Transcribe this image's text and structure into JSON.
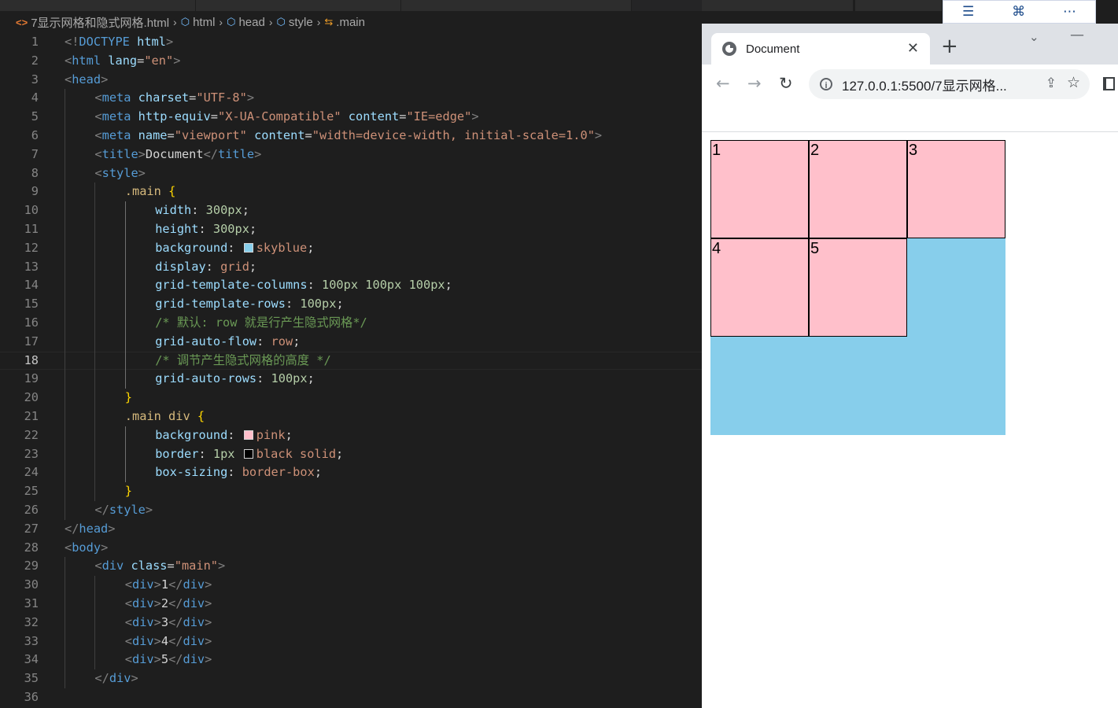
{
  "editor": {
    "breadcrumb": [
      "7显示网格和隐式网格.html",
      "html",
      "head",
      "style",
      ".main"
    ],
    "lines": [
      {
        "n": "1",
        "indent": 0,
        "tokens": [
          [
            "tg",
            "<!"
          ],
          [
            "tn",
            "DOCTYPE"
          ],
          [
            "tx",
            " "
          ],
          [
            "an",
            "html"
          ],
          [
            "tg",
            ">"
          ]
        ]
      },
      {
        "n": "2",
        "indent": 0,
        "tokens": [
          [
            "tg",
            "<"
          ],
          [
            "tn",
            "html"
          ],
          [
            "tx",
            " "
          ],
          [
            "an",
            "lang"
          ],
          [
            "tx",
            "="
          ],
          [
            "av",
            "\"en\""
          ],
          [
            "tg",
            ">"
          ]
        ]
      },
      {
        "n": "3",
        "indent": 0,
        "tokens": [
          [
            "tg",
            "<"
          ],
          [
            "tn",
            "head"
          ],
          [
            "tg",
            ">"
          ]
        ]
      },
      {
        "n": "4",
        "indent": 1,
        "tokens": [
          [
            "tg",
            "<"
          ],
          [
            "tn",
            "meta"
          ],
          [
            "tx",
            " "
          ],
          [
            "an",
            "charset"
          ],
          [
            "tx",
            "="
          ],
          [
            "av",
            "\"UTF-8\""
          ],
          [
            "tg",
            ">"
          ]
        ]
      },
      {
        "n": "5",
        "indent": 1,
        "tokens": [
          [
            "tg",
            "<"
          ],
          [
            "tn",
            "meta"
          ],
          [
            "tx",
            " "
          ],
          [
            "an",
            "http-equiv"
          ],
          [
            "tx",
            "="
          ],
          [
            "av",
            "\"X-UA-Compatible\""
          ],
          [
            "tx",
            " "
          ],
          [
            "an",
            "content"
          ],
          [
            "tx",
            "="
          ],
          [
            "av",
            "\"IE=edge\""
          ],
          [
            "tg",
            ">"
          ]
        ]
      },
      {
        "n": "6",
        "indent": 1,
        "tokens": [
          [
            "tg",
            "<"
          ],
          [
            "tn",
            "meta"
          ],
          [
            "tx",
            " "
          ],
          [
            "an",
            "name"
          ],
          [
            "tx",
            "="
          ],
          [
            "av",
            "\"viewport\""
          ],
          [
            "tx",
            " "
          ],
          [
            "an",
            "content"
          ],
          [
            "tx",
            "="
          ],
          [
            "av",
            "\"width=device-width, initial-scale=1.0\""
          ],
          [
            "tg",
            ">"
          ]
        ]
      },
      {
        "n": "7",
        "indent": 1,
        "tokens": [
          [
            "tg",
            "<"
          ],
          [
            "tn",
            "title"
          ],
          [
            "tg",
            ">"
          ],
          [
            "tx",
            "Document"
          ],
          [
            "tg",
            "</"
          ],
          [
            "tn",
            "title"
          ],
          [
            "tg",
            ">"
          ]
        ]
      },
      {
        "n": "8",
        "indent": 1,
        "tokens": [
          [
            "tg",
            "<"
          ],
          [
            "tn",
            "style"
          ],
          [
            "tg",
            ">"
          ]
        ]
      },
      {
        "n": "9",
        "indent": 2,
        "tokens": [
          [
            "sel",
            ".main"
          ],
          [
            "tx",
            " "
          ],
          [
            "br",
            "{"
          ]
        ]
      },
      {
        "n": "10",
        "indent": 3,
        "tokens": [
          [
            "pn",
            "width"
          ],
          [
            "tx",
            ": "
          ],
          [
            "nm",
            "300px"
          ],
          [
            "tx",
            ";"
          ]
        ]
      },
      {
        "n": "11",
        "indent": 3,
        "tokens": [
          [
            "pn",
            "height"
          ],
          [
            "tx",
            ": "
          ],
          [
            "nm",
            "300px"
          ],
          [
            "tx",
            ";"
          ]
        ]
      },
      {
        "n": "12",
        "indent": 3,
        "tokens": [
          [
            "pn",
            "background"
          ],
          [
            "tx",
            ": "
          ],
          [
            "swatch",
            "#87ceeb"
          ],
          [
            "kw",
            "skyblue"
          ],
          [
            "tx",
            ";"
          ]
        ]
      },
      {
        "n": "13",
        "indent": 3,
        "tokens": [
          [
            "pn",
            "display"
          ],
          [
            "tx",
            ": "
          ],
          [
            "kw",
            "grid"
          ],
          [
            "tx",
            ";"
          ]
        ]
      },
      {
        "n": "14",
        "indent": 3,
        "tokens": [
          [
            "pn",
            "grid-template-columns"
          ],
          [
            "tx",
            ": "
          ],
          [
            "nm",
            "100px"
          ],
          [
            "tx",
            " "
          ],
          [
            "nm",
            "100px"
          ],
          [
            "tx",
            " "
          ],
          [
            "nm",
            "100px"
          ],
          [
            "tx",
            ";"
          ]
        ]
      },
      {
        "n": "15",
        "indent": 3,
        "tokens": [
          [
            "pn",
            "grid-template-rows"
          ],
          [
            "tx",
            ": "
          ],
          [
            "nm",
            "100px"
          ],
          [
            "tx",
            ";"
          ]
        ]
      },
      {
        "n": "16",
        "indent": 3,
        "tokens": [
          [
            "cm",
            "/* 默认: row 就是行产生隐式网格*/"
          ]
        ]
      },
      {
        "n": "17",
        "indent": 3,
        "tokens": [
          [
            "pn",
            "grid-auto-flow"
          ],
          [
            "tx",
            ": "
          ],
          [
            "kw",
            "row"
          ],
          [
            "tx",
            ";"
          ]
        ]
      },
      {
        "n": "18",
        "indent": 3,
        "current": true,
        "tokens": [
          [
            "cm",
            "/* 调节产生隐式网格的高度 */"
          ]
        ]
      },
      {
        "n": "19",
        "indent": 3,
        "tokens": [
          [
            "pn",
            "grid-auto-rows"
          ],
          [
            "tx",
            ": "
          ],
          [
            "nm",
            "100px"
          ],
          [
            "tx",
            ";"
          ]
        ]
      },
      {
        "n": "20",
        "indent": 2,
        "tokens": [
          [
            "br",
            "}"
          ]
        ]
      },
      {
        "n": "21",
        "indent": 2,
        "tokens": [
          [
            "sel",
            ".main div"
          ],
          [
            "tx",
            " "
          ],
          [
            "br",
            "{"
          ]
        ]
      },
      {
        "n": "22",
        "indent": 3,
        "tokens": [
          [
            "pn",
            "background"
          ],
          [
            "tx",
            ": "
          ],
          [
            "swatch",
            "#ffc0cb"
          ],
          [
            "kw",
            "pink"
          ],
          [
            "tx",
            ";"
          ]
        ]
      },
      {
        "n": "23",
        "indent": 3,
        "tokens": [
          [
            "pn",
            "border"
          ],
          [
            "tx",
            ": "
          ],
          [
            "nm",
            "1px"
          ],
          [
            "tx",
            " "
          ],
          [
            "swatch",
            "#000000"
          ],
          [
            "kw",
            "black solid"
          ],
          [
            "tx",
            ";"
          ]
        ]
      },
      {
        "n": "24",
        "indent": 3,
        "tokens": [
          [
            "pn",
            "box-sizing"
          ],
          [
            "tx",
            ": "
          ],
          [
            "kw",
            "border-box"
          ],
          [
            "tx",
            ";"
          ]
        ]
      },
      {
        "n": "25",
        "indent": 2,
        "tokens": [
          [
            "br",
            "}"
          ]
        ]
      },
      {
        "n": "26",
        "indent": 1,
        "tokens": [
          [
            "tg",
            "</"
          ],
          [
            "tn",
            "style"
          ],
          [
            "tg",
            ">"
          ]
        ]
      },
      {
        "n": "27",
        "indent": 0,
        "tokens": [
          [
            "tg",
            "</"
          ],
          [
            "tn",
            "head"
          ],
          [
            "tg",
            ">"
          ]
        ]
      },
      {
        "n": "28",
        "indent": 0,
        "tokens": [
          [
            "tg",
            "<"
          ],
          [
            "tn",
            "body"
          ],
          [
            "tg",
            ">"
          ]
        ]
      },
      {
        "n": "29",
        "indent": 1,
        "tokens": [
          [
            "tg",
            "<"
          ],
          [
            "tn",
            "div"
          ],
          [
            "tx",
            " "
          ],
          [
            "an",
            "class"
          ],
          [
            "tx",
            "="
          ],
          [
            "av",
            "\"main\""
          ],
          [
            "tg",
            ">"
          ]
        ]
      },
      {
        "n": "30",
        "indent": 2,
        "tokens": [
          [
            "tg",
            "<"
          ],
          [
            "tn",
            "div"
          ],
          [
            "tg",
            ">"
          ],
          [
            "tx",
            "1"
          ],
          [
            "tg",
            "</"
          ],
          [
            "tn",
            "div"
          ],
          [
            "tg",
            ">"
          ]
        ]
      },
      {
        "n": "31",
        "indent": 2,
        "tokens": [
          [
            "tg",
            "<"
          ],
          [
            "tn",
            "div"
          ],
          [
            "tg",
            ">"
          ],
          [
            "tx",
            "2"
          ],
          [
            "tg",
            "</"
          ],
          [
            "tn",
            "div"
          ],
          [
            "tg",
            ">"
          ]
        ]
      },
      {
        "n": "32",
        "indent": 2,
        "tokens": [
          [
            "tg",
            "<"
          ],
          [
            "tn",
            "div"
          ],
          [
            "tg",
            ">"
          ],
          [
            "tx",
            "3"
          ],
          [
            "tg",
            "</"
          ],
          [
            "tn",
            "div"
          ],
          [
            "tg",
            ">"
          ]
        ]
      },
      {
        "n": "33",
        "indent": 2,
        "tokens": [
          [
            "tg",
            "<"
          ],
          [
            "tn",
            "div"
          ],
          [
            "tg",
            ">"
          ],
          [
            "tx",
            "4"
          ],
          [
            "tg",
            "</"
          ],
          [
            "tn",
            "div"
          ],
          [
            "tg",
            ">"
          ]
        ]
      },
      {
        "n": "34",
        "indent": 2,
        "tokens": [
          [
            "tg",
            "<"
          ],
          [
            "tn",
            "div"
          ],
          [
            "tg",
            ">"
          ],
          [
            "tx",
            "5"
          ],
          [
            "tg",
            "</"
          ],
          [
            "tn",
            "div"
          ],
          [
            "tg",
            ">"
          ]
        ]
      },
      {
        "n": "35",
        "indent": 1,
        "tokens": [
          [
            "tg",
            "</"
          ],
          [
            "tn",
            "div"
          ],
          [
            "tg",
            ">"
          ]
        ]
      },
      {
        "n": "36",
        "indent": 0,
        "tokens": []
      }
    ]
  },
  "browser": {
    "tab_title": "Document",
    "url": "127.0.0.1:5500/7显示网格...",
    "grid_cells": [
      "1",
      "2",
      "3",
      "4",
      "5"
    ],
    "colors": {
      "container": "#87ceeb",
      "cell": "#ffc0cb",
      "cell_border": "#000000"
    }
  }
}
